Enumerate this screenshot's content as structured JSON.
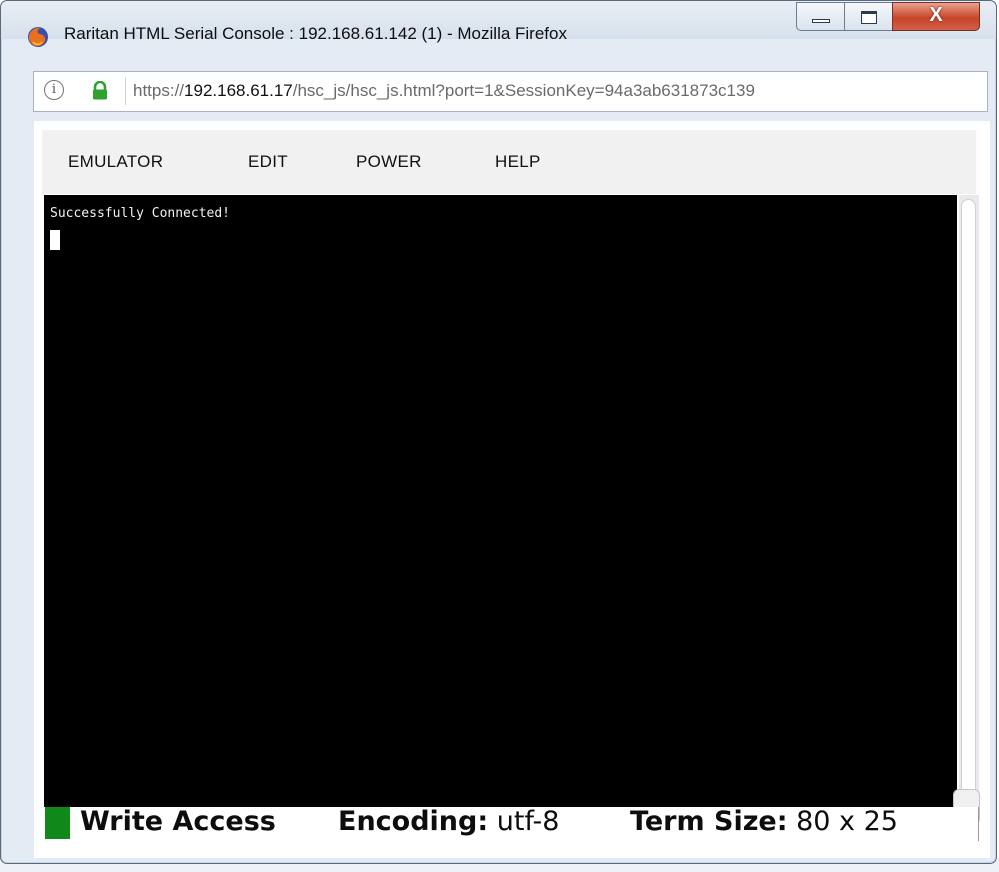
{
  "window": {
    "title": "Raritan HTML Serial Console : 192.168.61.142 (1) - Mozilla Firefox",
    "buttons": {
      "minimize": "minimize",
      "maximize": "maximize",
      "close": "X"
    }
  },
  "address_bar": {
    "url_prefix": "https://",
    "url_host": "192.168.61.17",
    "url_path": "/hsc_js/hsc_js.html?port=1&SessionKey=94a3ab631873c139"
  },
  "menu": {
    "items": [
      {
        "label": "EMULATOR"
      },
      {
        "label": "EDIT"
      },
      {
        "label": "POWER"
      },
      {
        "label": "HELP"
      }
    ]
  },
  "terminal": {
    "output": "Successfully Connected!",
    "background_color": "#000000",
    "text_color": "#f2f2f2"
  },
  "status": {
    "access": "Write Access",
    "encoding_label": "Encoding:",
    "encoding_value": " utf-8",
    "termsize_label": "Term Size:",
    "termsize_value": " 80 x 25",
    "indicator_color": "#11891a"
  },
  "icons": {
    "app": "firefox-icon",
    "info": "info-icon",
    "lock": "lock-icon"
  }
}
